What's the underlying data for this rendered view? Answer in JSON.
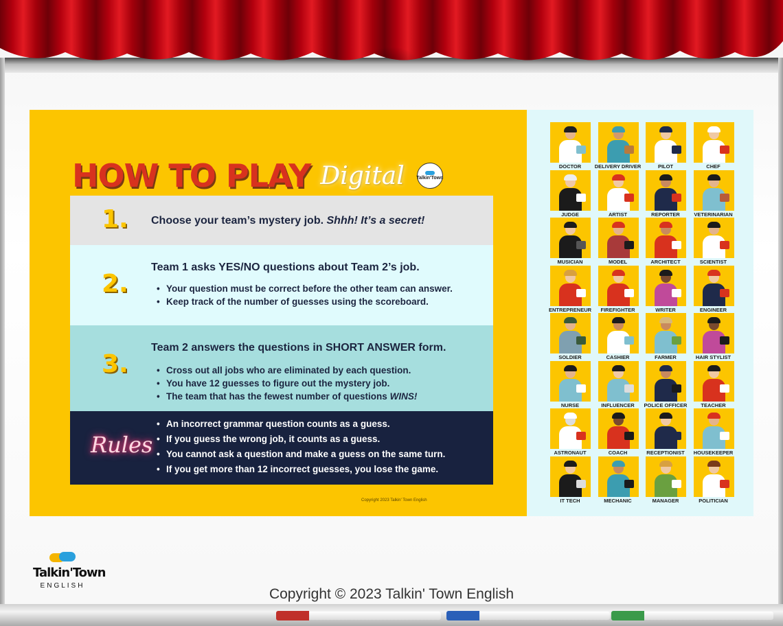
{
  "header": {
    "title": "HOW TO PLAY",
    "subtitle": "Digital",
    "mini_logo_text": "Talkin'Town"
  },
  "steps": [
    {
      "number": "1.",
      "heading": "Choose your team’s mystery job.",
      "heading_emphasis": "Shhh! It’s a secret!"
    },
    {
      "number": "2.",
      "heading": "Team 1 asks YES/NO questions about Team 2’s job.",
      "bullets": [
        "Your question must be correct before the other team can answer.",
        "Keep track of the number of guesses using the scoreboard."
      ]
    },
    {
      "number": "3.",
      "heading": "Team 2 answers the questions in SHORT ANSWER form.",
      "bullets": [
        "Cross out all jobs who are eliminated by each question.",
        "You have 12 guesses to figure out the mystery job."
      ],
      "last_bullet_text": "The team that has the fewest number of questions",
      "last_bullet_emphasis": "WINS!"
    }
  ],
  "rules": {
    "label": "Rules",
    "bullets": [
      "An incorrect grammar question counts as a guess.",
      "If you guess the wrong job, it counts as a guess.",
      "You cannot ask a question and make a guess on the same turn.",
      "If you get more than 12 incorrect guesses, you lose the game."
    ]
  },
  "slide_copyright": "Copyright 2023 Talkin' Town English",
  "jobs": [
    {
      "label": "DOCTOR",
      "skin": "#e4b48c",
      "hair": "#1f1f1f",
      "outfit": "#ffffff",
      "prop": "#7fbfcf"
    },
    {
      "label": "DELIVERY DRIVER",
      "skin": "#d49a6a",
      "hair": "#3c9db0",
      "outfit": "#3c9db0",
      "prop": "#b87a3d"
    },
    {
      "label": "PILOT",
      "skin": "#f0c9a4",
      "hair": "#1f2a4a",
      "outfit": "#ffffff",
      "prop": "#1f2a4a"
    },
    {
      "label": "CHEF",
      "skin": "#f0c9a4",
      "hair": "#ffffff",
      "outfit": "#ffffff",
      "prop": "#d8321e"
    },
    {
      "label": "JUDGE",
      "skin": "#f0c9a4",
      "hair": "#eeeeee",
      "outfit": "#1b1b1b",
      "prop": "#ffffff"
    },
    {
      "label": "ARTIST",
      "skin": "#f0c9a4",
      "hair": "#d8321e",
      "outfit": "#ffffff",
      "prop": "#d8321e"
    },
    {
      "label": "REPORTER",
      "skin": "#c98a5e",
      "hair": "#1b1b1b",
      "outfit": "#1f2a4a",
      "prop": "#d8321e"
    },
    {
      "label": "VETERINARIAN",
      "skin": "#e4b48c",
      "hair": "#1b1b1b",
      "outfit": "#7fbfcf",
      "prop": "#b85c3a"
    },
    {
      "label": "MUSICIAN",
      "skin": "#f0c9a4",
      "hair": "#1b1b1b",
      "outfit": "#1b1b1b",
      "prop": "#555555"
    },
    {
      "label": "MODEL",
      "skin": "#e4b48c",
      "hair": "#d8321e",
      "outfit": "#a83a3a",
      "prop": "#1b1b1b"
    },
    {
      "label": "ARCHITECT",
      "skin": "#c98a5e",
      "hair": "#d8321e",
      "outfit": "#d8321e",
      "prop": "#ffffff"
    },
    {
      "label": "SCIENTIST",
      "skin": "#e4b48c",
      "hair": "#1b1b1b",
      "outfit": "#ffffff",
      "prop": "#d8321e"
    },
    {
      "label": "ENTREPRENEUR",
      "skin": "#f0c9a4",
      "hair": "#d8a040",
      "outfit": "#d8321e",
      "prop": "#ffffff"
    },
    {
      "label": "FIREFIGHTER",
      "skin": "#f0c9a4",
      "hair": "#d8321e",
      "outfit": "#d8321e",
      "prop": "#ffffff"
    },
    {
      "label": "WRITER",
      "skin": "#7a4a2e",
      "hair": "#1b1b1b",
      "outfit": "#c04a9a",
      "prop": "#ffffff"
    },
    {
      "label": "ENGINEER",
      "skin": "#f0c9a4",
      "hair": "#d8321e",
      "outfit": "#1f2a4a",
      "prop": "#d8321e"
    },
    {
      "label": "SOLDIER",
      "skin": "#e4b48c",
      "hair": "#3a5a3a",
      "outfit": "#7fa0b0",
      "prop": "#3a5a3a"
    },
    {
      "label": "CASHIER",
      "skin": "#c98a5e",
      "hair": "#1b1b1b",
      "outfit": "#ffffff",
      "prop": "#7fbfcf"
    },
    {
      "label": "FARMER",
      "skin": "#c98a5e",
      "hair": "#d8b87a",
      "outfit": "#7fbfcf",
      "prop": "#6aa040"
    },
    {
      "label": "HAIR STYLIST",
      "skin": "#7a4a2e",
      "hair": "#1b1b1b",
      "outfit": "#c04a9a",
      "prop": "#1b1b1b"
    },
    {
      "label": "NURSE",
      "skin": "#e4b48c",
      "hair": "#1b1b1b",
      "outfit": "#7fbfcf",
      "prop": "#ffffff"
    },
    {
      "label": "INFLUENCER",
      "skin": "#f0c9a4",
      "hair": "#1b1b1b",
      "outfit": "#7fbfcf",
      "prop": "#dddddd"
    },
    {
      "label": "POLICE OFFICER",
      "skin": "#c98a5e",
      "hair": "#1f2a4a",
      "outfit": "#1f2a4a",
      "prop": "#1b1b1b"
    },
    {
      "label": "TEACHER",
      "skin": "#f0c9a4",
      "hair": "#1b1b1b",
      "outfit": "#d8321e",
      "prop": "#ffffff"
    },
    {
      "label": "ASTRONAUT",
      "skin": "#dddddd",
      "hair": "#ffffff",
      "outfit": "#ffffff",
      "prop": "#d8321e"
    },
    {
      "label": "COACH",
      "skin": "#7a4a2e",
      "hair": "#1b1b1b",
      "outfit": "#d8321e",
      "prop": "#1b1b1b"
    },
    {
      "label": "RECEPTIONIST",
      "skin": "#f0c9a4",
      "hair": "#1b1b1b",
      "outfit": "#1f2a4a",
      "prop": "#1f2a4a"
    },
    {
      "label": "HOUSEKEEPER",
      "skin": "#e4b48c",
      "hair": "#d8321e",
      "outfit": "#7fbfcf",
      "prop": "#ffffff"
    },
    {
      "label": "IT TECH",
      "skin": "#f0c9a4",
      "hair": "#1b1b1b",
      "outfit": "#1b1b1b",
      "prop": "#dddddd"
    },
    {
      "label": "MECHANIC",
      "skin": "#c98a5e",
      "hair": "#3c9db0",
      "outfit": "#3c9db0",
      "prop": "#1b1b1b"
    },
    {
      "label": "MANAGER",
      "skin": "#f0c9a4",
      "hair": "#d8a040",
      "outfit": "#6aa040",
      "prop": "#ffffff"
    },
    {
      "label": "POLITICIAN",
      "skin": "#f0c9a4",
      "hair": "#7a3a1a",
      "outfit": "#ffffff",
      "prop": "#d8321e"
    }
  ],
  "brand": {
    "name": "Talkin'Town",
    "tagline": "ENGLISH"
  },
  "footer": {
    "copyright": "Copyright © 2023 Talkin' Town English"
  },
  "markers": [
    {
      "color": "#c0302a"
    },
    {
      "color": "#2a5fb8"
    },
    {
      "color": "#3a9a4a"
    }
  ],
  "colors": {
    "slide_yellow": "#fcc500",
    "title_red": "#d8321e",
    "navy": "#1c2540",
    "jobs_panel": "#e0f8fa"
  }
}
